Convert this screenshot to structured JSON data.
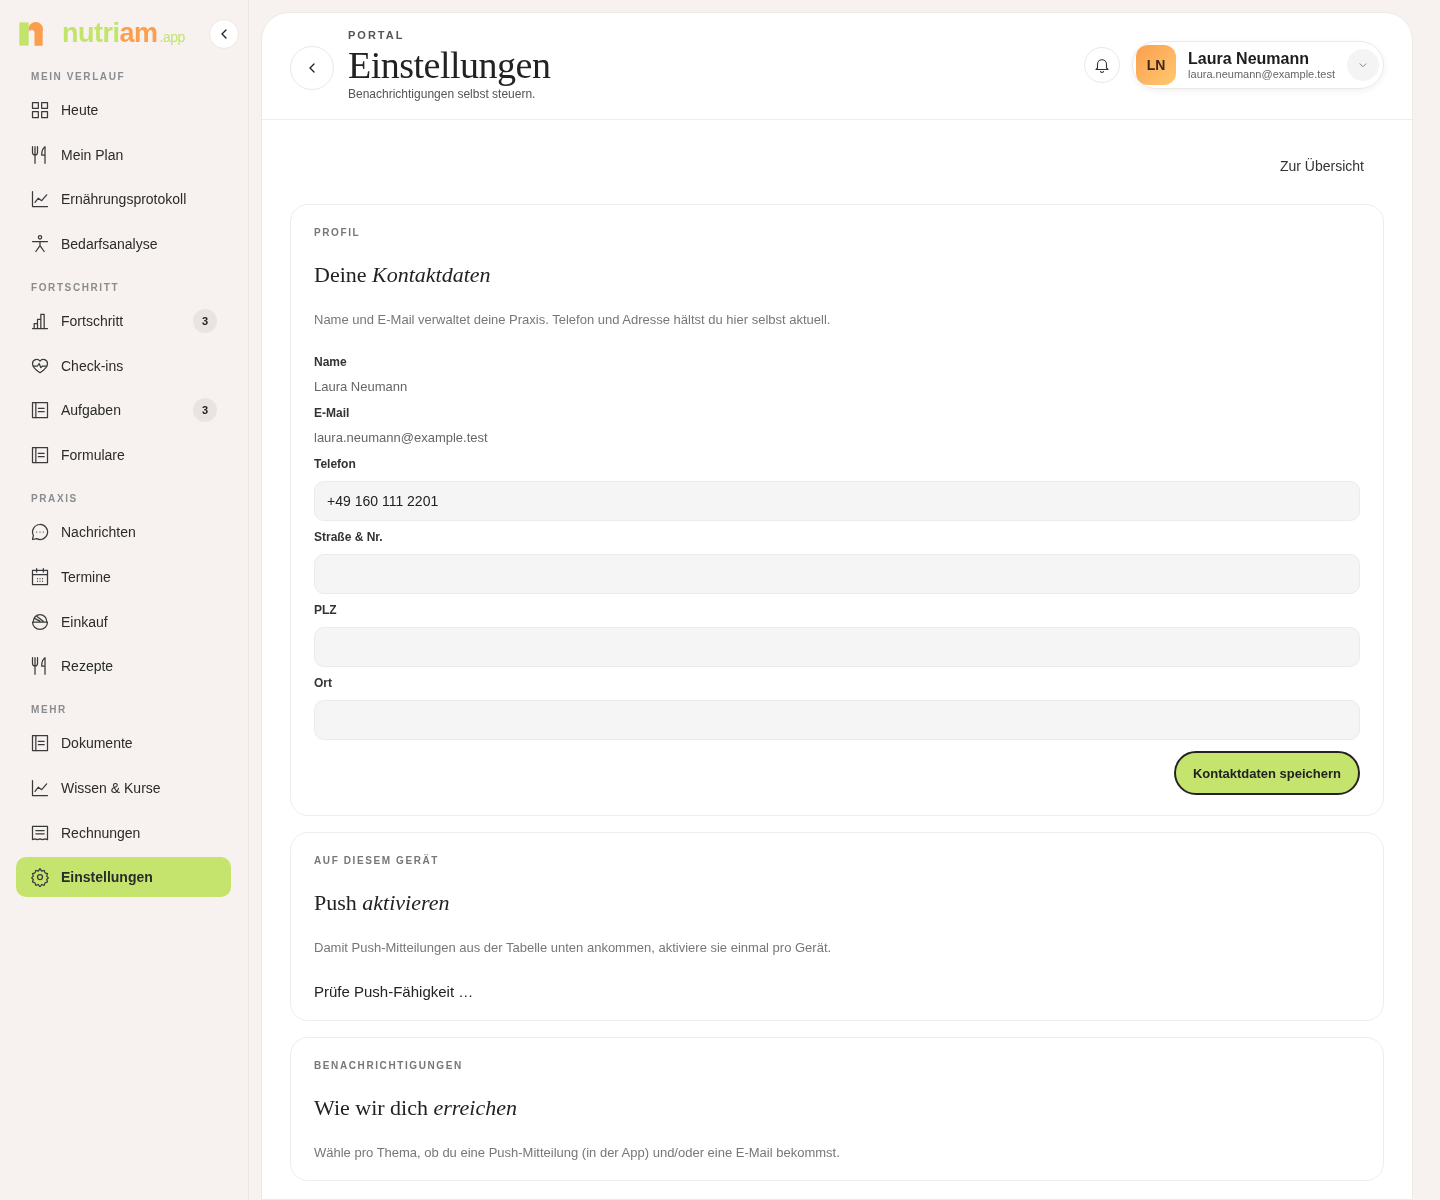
{
  "sidebar": {
    "logo": {
      "word_start": "nutri",
      "word_end": "am",
      "suffix": ".app"
    },
    "groups": [
      {
        "title": "MEIN VERLAUF",
        "items": [
          {
            "label": "Heute",
            "selected": false
          },
          {
            "label": "Mein Plan",
            "selected": false
          },
          {
            "label": "Ernährungsprotokoll",
            "selected": false
          },
          {
            "label": "Bedarfsanalyse",
            "selected": false
          }
        ]
      },
      {
        "title": "FORTSCHRITT",
        "items": [
          {
            "label": "Fortschritt",
            "selected": false,
            "badge": "3"
          },
          {
            "label": "Check-ins",
            "selected": false
          },
          {
            "label": "Aufgaben",
            "selected": false,
            "badge": "3"
          },
          {
            "label": "Formulare",
            "selected": false
          }
        ]
      },
      {
        "title": "PRAXIS",
        "items": [
          {
            "label": "Nachrichten",
            "selected": false
          },
          {
            "label": "Termine",
            "selected": false
          },
          {
            "label": "Einkauf",
            "selected": false
          },
          {
            "label": "Rezepte",
            "selected": false
          }
        ]
      },
      {
        "title": "MEHR",
        "items": [
          {
            "label": "Dokumente",
            "selected": false
          },
          {
            "label": "Wissen & Kurse",
            "selected": false
          },
          {
            "label": "Rechnungen",
            "selected": false
          },
          {
            "label": "Einstellungen",
            "selected": true
          }
        ]
      }
    ]
  },
  "header": {
    "eyebrow": "PORTAL",
    "title": "Einstellungen",
    "subtitle": "Benachrichtigungen selbst steuern.",
    "user": {
      "initials": "LN",
      "name": "Laura Neumann",
      "email": "laura.neumann@example.test"
    }
  },
  "overview_link": "Zur Übersicht",
  "sections": [
    {
      "eyebrow": "PROFIL",
      "title": "Deine *Kontaktdaten*",
      "description": "Name und E-Mail verwaltet deine Praxis. Telefon und Adresse hältst du hier selbst aktuell.",
      "fields": [
        {
          "kind": "readonly",
          "label": "Name",
          "value": "Laura Neumann"
        },
        {
          "kind": "readonly",
          "label": "E-Mail",
          "value": "laura.neumann@example.test"
        },
        {
          "kind": "input",
          "label": "Telefon",
          "value": "+49 160 111 2201"
        },
        {
          "kind": "input",
          "label": "Straße & Nr."
        },
        {
          "kind": "input",
          "label": "PLZ"
        },
        {
          "kind": "input",
          "label": "Ort"
        }
      ],
      "button": "Kontaktdaten speichern"
    },
    {
      "eyebrow": "AUF DIESEM GERÄT",
      "title": "Push *aktivieren*",
      "description": "Damit Push-Mitteilungen aus der Tabelle unten ankommen, aktiviere sie einmal pro Gerät.",
      "status": "Prüfe Push-Fähigkeit …"
    },
    {
      "eyebrow": "BENACHRICHTIGUNGEN",
      "title": "Wie wir dich *erreichen*",
      "description": "Wähle pro Thema, ob du eine Push-Mitteilung (in der App) und/oder eine E-Mail bekommst."
    }
  ]
}
